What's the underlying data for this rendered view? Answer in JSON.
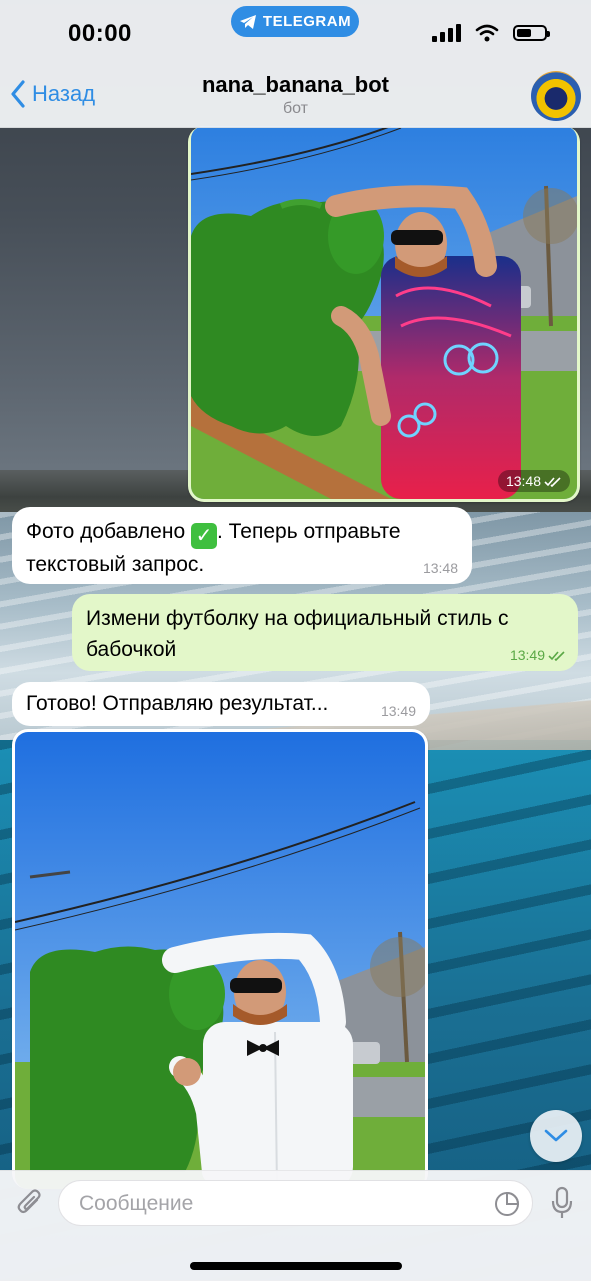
{
  "status_bar": {
    "time": "00:00",
    "app_pill": "TELEGRAM"
  },
  "header": {
    "back_label": "Назад",
    "title": "nana_banana_bot",
    "subtitle": "бот"
  },
  "messages": [
    {
      "type": "photo",
      "direction": "outgoing",
      "time": "13:48",
      "status": "read"
    },
    {
      "type": "text",
      "direction": "incoming",
      "text_before": "Фото добавлено ",
      "emoji": "✅",
      "text_after": ". Теперь отправьте текстовый запрос.",
      "time": "13:48"
    },
    {
      "type": "text",
      "direction": "outgoing",
      "text": "Измени футболку на официальный стиль с бабочкой",
      "time": "13:49",
      "status": "read"
    },
    {
      "type": "text",
      "direction": "incoming",
      "text": "Готово! Отправляю результат...",
      "time": "13:49"
    },
    {
      "type": "photo",
      "direction": "incoming"
    }
  ],
  "composer": {
    "placeholder": "Сообщение"
  },
  "colors": {
    "accent": "#2f8de4",
    "outgoing_bubble": "#e3f7c9",
    "incoming_bubble": "#ffffff",
    "read_check": "#5aa845"
  },
  "icons": [
    "telegram-icon",
    "chevron-left-icon",
    "attach-icon",
    "sticker-icon",
    "mic-icon",
    "chevron-down-icon",
    "double-check-icon",
    "wifi-icon",
    "signal-icon",
    "battery-icon"
  ],
  "battery_level": 0.55
}
